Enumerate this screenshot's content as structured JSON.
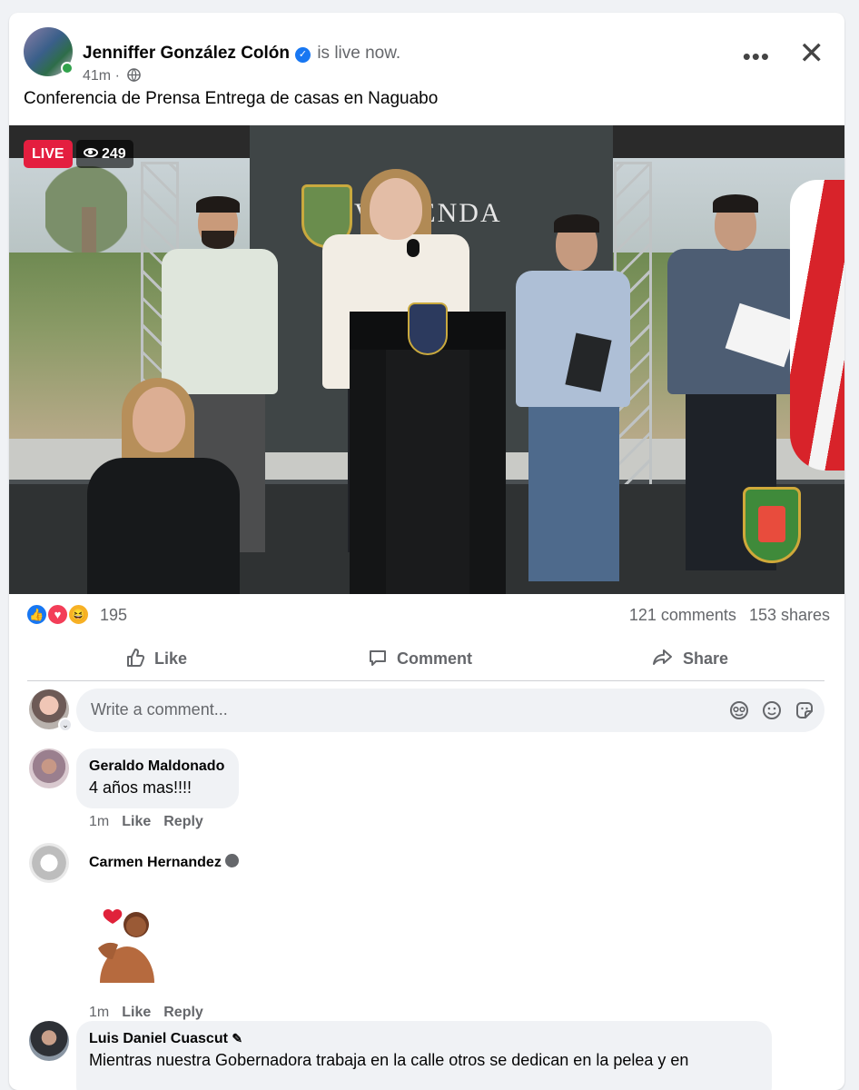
{
  "post": {
    "author": "Jenniffer González Colón",
    "status": "is live now.",
    "time": "41m",
    "separator": "·",
    "text": "Conferencia de Prensa Entrega de casas en Naguabo"
  },
  "video": {
    "live_label": "LIVE",
    "viewers": "249",
    "backdrop_text": "VIVIENDA"
  },
  "stats": {
    "reactions_count": "195",
    "comments": "121 comments",
    "shares": "153 shares",
    "reaction_icons": [
      "like-icon",
      "love-icon",
      "haha-icon"
    ]
  },
  "actions": {
    "like": "Like",
    "comment": "Comment",
    "share": "Share"
  },
  "composer": {
    "placeholder": "Write a comment...",
    "icons": [
      "avatar-sticker-icon",
      "emoji-icon",
      "sticker-icon"
    ]
  },
  "comments": [
    {
      "name": "Geraldo Maldonado",
      "text": "4 años mas!!!!",
      "time": "1m",
      "like": "Like",
      "reply": "Reply"
    },
    {
      "name": "Carmen Hernandez",
      "text": "",
      "time": "1m",
      "like": "Like",
      "reply": "Reply",
      "sticker": "heart-sticker"
    },
    {
      "name": "Luis Daniel Cuascut",
      "text": "Mientras nuestra Gobernadora trabaja en la calle otros se dedican en la pelea y en"
    }
  ],
  "colors": {
    "accent": "#1877f2",
    "live_red": "#e41e3f",
    "muted_text": "#65676b",
    "bubble_bg": "#f0f2f5"
  }
}
